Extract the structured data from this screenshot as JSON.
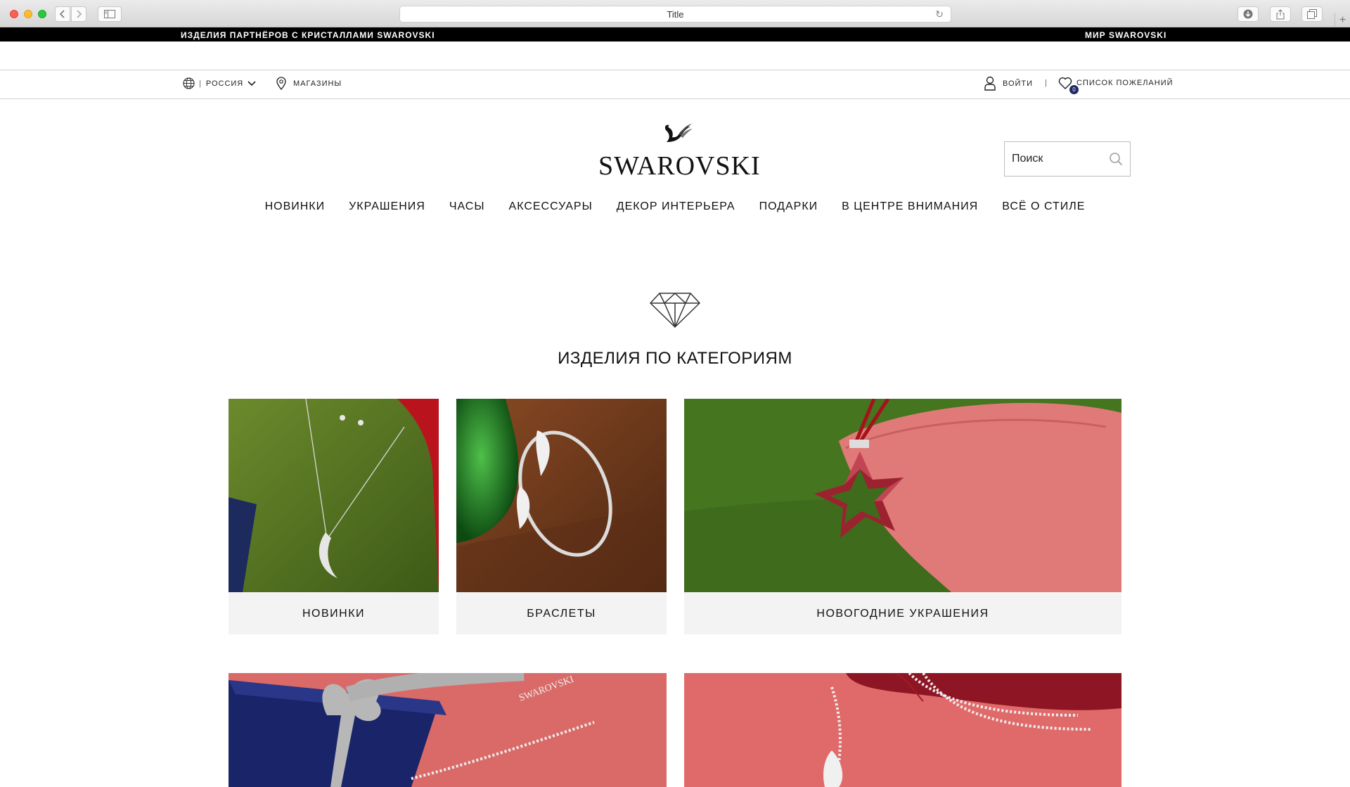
{
  "browser": {
    "tab_title": "Title",
    "reload_icon": "reload-icon",
    "new_tab": "+"
  },
  "promo": {
    "left": "ИЗДЕЛИЯ ПАРТНЁРОВ С КРИСТАЛЛАМИ SWAROVSKI",
    "right": "МИР SWAROVSKI"
  },
  "utility": {
    "country_sep": "|",
    "country": "РОССИЯ",
    "stores": "МАГАЗИНЫ",
    "login": "ВОЙТИ",
    "sep": "|",
    "wishlist": "СПИСОК ПОЖЕЛАНИЙ",
    "wishlist_count": "0"
  },
  "brand": {
    "name": "SWAROVSKI"
  },
  "search": {
    "placeholder": "Поиск"
  },
  "nav": {
    "items": [
      "НОВИНКИ",
      "УКРАШЕНИЯ",
      "ЧАСЫ",
      "АКСЕССУАРЫ",
      "ДЕКОР ИНТЕРЬЕРА",
      "ПОДАРКИ",
      "В ЦЕНТРЕ ВНИМАНИЯ",
      "ВСЁ О СТИЛЕ"
    ]
  },
  "categories": {
    "title": "ИЗДЕЛИЯ ПО КАТЕГОРИЯМ",
    "cards": [
      {
        "label": "НОВИНКИ"
      },
      {
        "label": "БРАСЛЕТЫ"
      },
      {
        "label": "НОВОГОДНИЕ УКРАШЕНИЯ"
      }
    ],
    "bottom_image_text": "SWAROVSKI"
  },
  "colors": {
    "accent": "#1e2a66",
    "promo_bg": "#000000"
  }
}
